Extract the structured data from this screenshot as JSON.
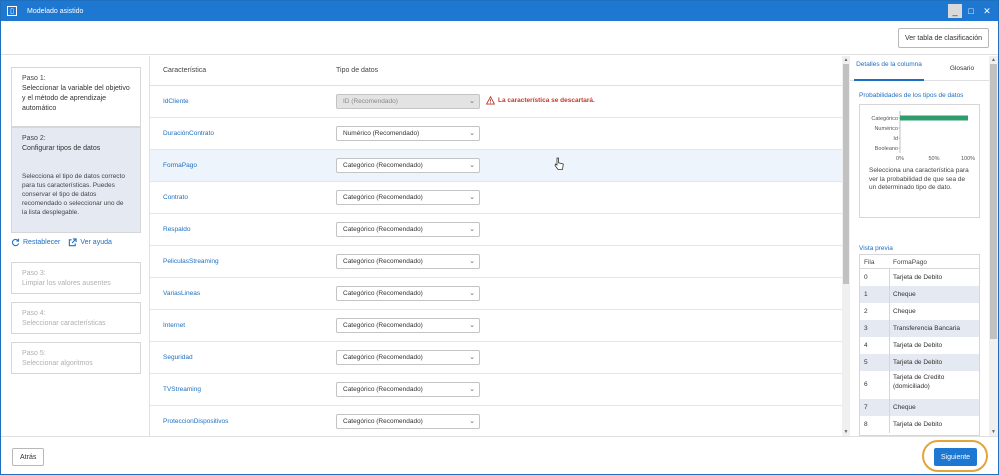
{
  "window": {
    "title": "Modelado asistido",
    "minimize_symbol": "_",
    "maximize_symbol": "□",
    "close_symbol": "✕"
  },
  "toolbar": {
    "leaderboard_label": "Ver tabla de clasificación"
  },
  "steps": [
    {
      "num": "Paso 1:",
      "title": "Seleccionar la variable del objetivo y el método de aprendizaje automático",
      "state": "done"
    },
    {
      "num": "Paso 2:",
      "title": "Configurar tipos de datos",
      "state": "active",
      "description": "Selecciona el tipo de datos correcto para tus características. Puedes conservar el tipo de datos recomendado o seleccionar uno de la lista desplegable."
    },
    {
      "num": "Paso 3:",
      "title": "Limpiar los valores ausentes",
      "state": "disabled"
    },
    {
      "num": "Paso 4:",
      "title": "Seleccionar características",
      "state": "disabled"
    },
    {
      "num": "Paso 5:",
      "title": "Seleccionar algoritmos",
      "state": "disabled"
    }
  ],
  "step_links": {
    "reset": "Restablecer",
    "help": "Ver ayuda"
  },
  "table": {
    "col_feature": "Característica",
    "col_type": "Tipo de datos",
    "rows": [
      {
        "feature": "IdCliente",
        "type": "ID (Recomendado)",
        "disabled": true,
        "warning": "La característica se descartará."
      },
      {
        "feature": "DuraciónContrato",
        "type": "Numérico (Recomendado)"
      },
      {
        "feature": "FormaPago",
        "type": "Categórico (Recomendado)",
        "highlight": true
      },
      {
        "feature": "Contrato",
        "type": "Categórico (Recomendado)"
      },
      {
        "feature": "Respaldo",
        "type": "Categórico (Recomendado)"
      },
      {
        "feature": "PeliculasStreaming",
        "type": "Categórico (Recomendado)"
      },
      {
        "feature": "VariasLineas",
        "type": "Categórico (Recomendado)"
      },
      {
        "feature": "Internet",
        "type": "Categórico (Recomendado)"
      },
      {
        "feature": "Seguridad",
        "type": "Categórico (Recomendado)"
      },
      {
        "feature": "TVStreaming",
        "type": "Categórico (Recomendado)"
      },
      {
        "feature": "ProteccionDispositivos",
        "type": "Categórico (Recomendado)"
      }
    ]
  },
  "right_panel": {
    "tab_details": "Detalles de la columna",
    "tab_glossary": "Glosario",
    "prob_title": "Probabilidades de los tipos de datos",
    "prob_hint": "Selecciona una característica para ver la probabilidad de que sea de un determinado tipo de dato.",
    "preview_title": "Vista previa",
    "preview_col_row": "Fila",
    "preview_col_value": "FormaPago",
    "preview_rows": [
      {
        "row": "0",
        "value": "Tarjeta de Debito"
      },
      {
        "row": "1",
        "value": "Cheque"
      },
      {
        "row": "2",
        "value": "Cheque"
      },
      {
        "row": "3",
        "value": "Transferencia Bancaria"
      },
      {
        "row": "4",
        "value": "Tarjeta de Debito"
      },
      {
        "row": "5",
        "value": "Tarjeta de Debito"
      },
      {
        "row": "6",
        "value": "Tarjeta de Credito (domiciliado)"
      },
      {
        "row": "7",
        "value": "Cheque"
      },
      {
        "row": "8",
        "value": "Tarjeta de Debito"
      }
    ]
  },
  "chart_data": {
    "type": "bar",
    "orientation": "horizontal",
    "categories": [
      "Categórico",
      "Numérico",
      "Id",
      "Booleano"
    ],
    "values": [
      100,
      0,
      0,
      0
    ],
    "xticks": [
      "0%",
      "50%",
      "100%"
    ],
    "xlim": [
      0,
      100
    ],
    "bar_color": "#2e9e6e",
    "title": "",
    "xlabel": "",
    "ylabel": ""
  },
  "bottom": {
    "back_label": "Atrás",
    "next_label": "Siguiente"
  },
  "colors": {
    "accent": "#1e78d2",
    "link": "#1e6fc1",
    "warning": "#c0392b",
    "highlight_ring": "#e0a63a"
  }
}
